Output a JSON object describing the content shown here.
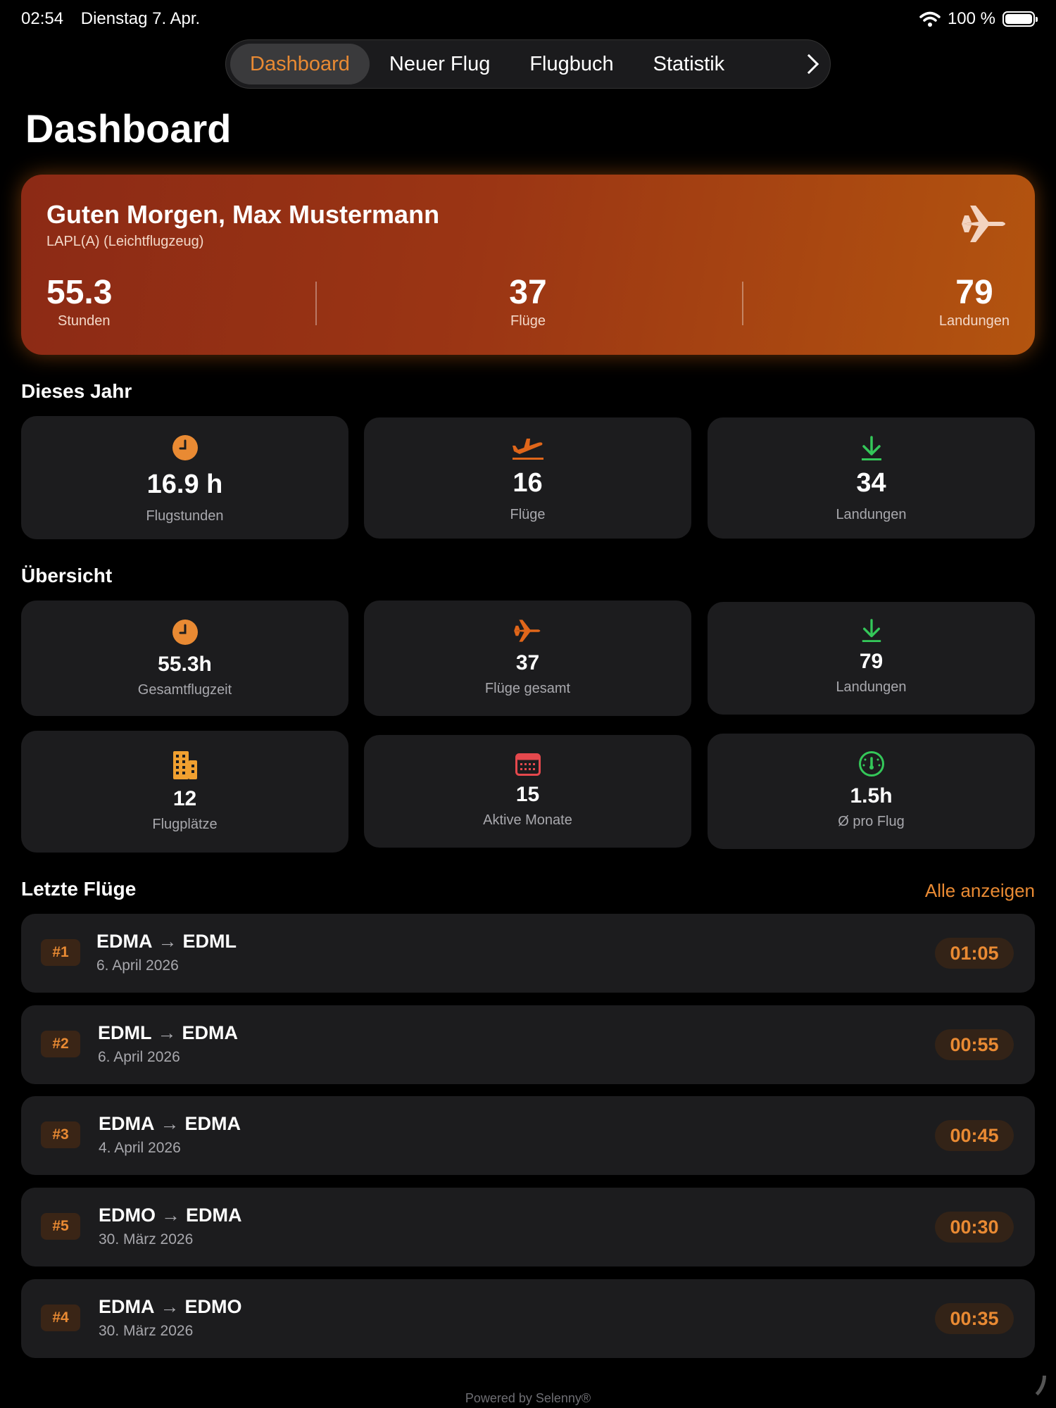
{
  "status": {
    "time": "02:54",
    "date": "Dienstag 7. Apr.",
    "battery": "100 %"
  },
  "tabs": [
    {
      "label": "Dashboard"
    },
    {
      "label": "Neuer Flug"
    },
    {
      "label": "Flugbuch"
    },
    {
      "label": "Statistik"
    }
  ],
  "page_title": "Dashboard",
  "hero": {
    "greeting": "Guten Morgen, Max Mustermann",
    "license": "LAPL(A) (Leichtflugzeug)",
    "stats": [
      {
        "value": "55.3",
        "label": "Stunden"
      },
      {
        "value": "37",
        "label": "Flüge"
      },
      {
        "value": "79",
        "label": "Landungen"
      }
    ]
  },
  "this_year": {
    "title": "Dieses Jahr",
    "cards": [
      {
        "value": "16.9 h",
        "label": "Flugstunden",
        "icon": "clock-icon",
        "color": "#e98a33"
      },
      {
        "value": "16",
        "label": "Flüge",
        "icon": "takeoff-icon",
        "color": "#e0661a"
      },
      {
        "value": "34",
        "label": "Landungen",
        "icon": "landing-icon",
        "color": "#34c759"
      }
    ]
  },
  "overview": {
    "title": "Übersicht",
    "cards": [
      {
        "value": "55.3h",
        "label": "Gesamtflugzeit",
        "icon": "clock-icon",
        "color": "#e98a33"
      },
      {
        "value": "37",
        "label": "Flüge gesamt",
        "icon": "airplane-icon",
        "color": "#e0661a"
      },
      {
        "value": "79",
        "label": "Landungen",
        "icon": "landing-icon",
        "color": "#34c759"
      },
      {
        "value": "12",
        "label": "Flugplätze",
        "icon": "building-icon",
        "color": "#f0a030"
      },
      {
        "value": "15",
        "label": "Aktive Monate",
        "icon": "calendar-icon",
        "color": "#e5484d"
      },
      {
        "value": "1.5h",
        "label": "Ø pro Flug",
        "icon": "gauge-icon",
        "color": "#34c759"
      }
    ]
  },
  "recent": {
    "title": "Letzte Flüge",
    "see_all": "Alle anzeigen",
    "flights": [
      {
        "num": "#1",
        "from": "EDMA",
        "to": "EDML",
        "date": "6. April 2026",
        "duration": "01:05"
      },
      {
        "num": "#2",
        "from": "EDML",
        "to": "EDMA",
        "date": "6. April 2026",
        "duration": "00:55"
      },
      {
        "num": "#3",
        "from": "EDMA",
        "to": "EDMA",
        "date": "4. April 2026",
        "duration": "00:45"
      },
      {
        "num": "#5",
        "from": "EDMO",
        "to": "EDMA",
        "date": "30. März 2026",
        "duration": "00:30"
      },
      {
        "num": "#4",
        "from": "EDMA",
        "to": "EDMO",
        "date": "30. März 2026",
        "duration": "00:35"
      }
    ]
  },
  "footer": "Powered by Selenny®",
  "colors": {
    "accent": "#e98a33",
    "card": "#1c1c1e",
    "green": "#34c759"
  }
}
